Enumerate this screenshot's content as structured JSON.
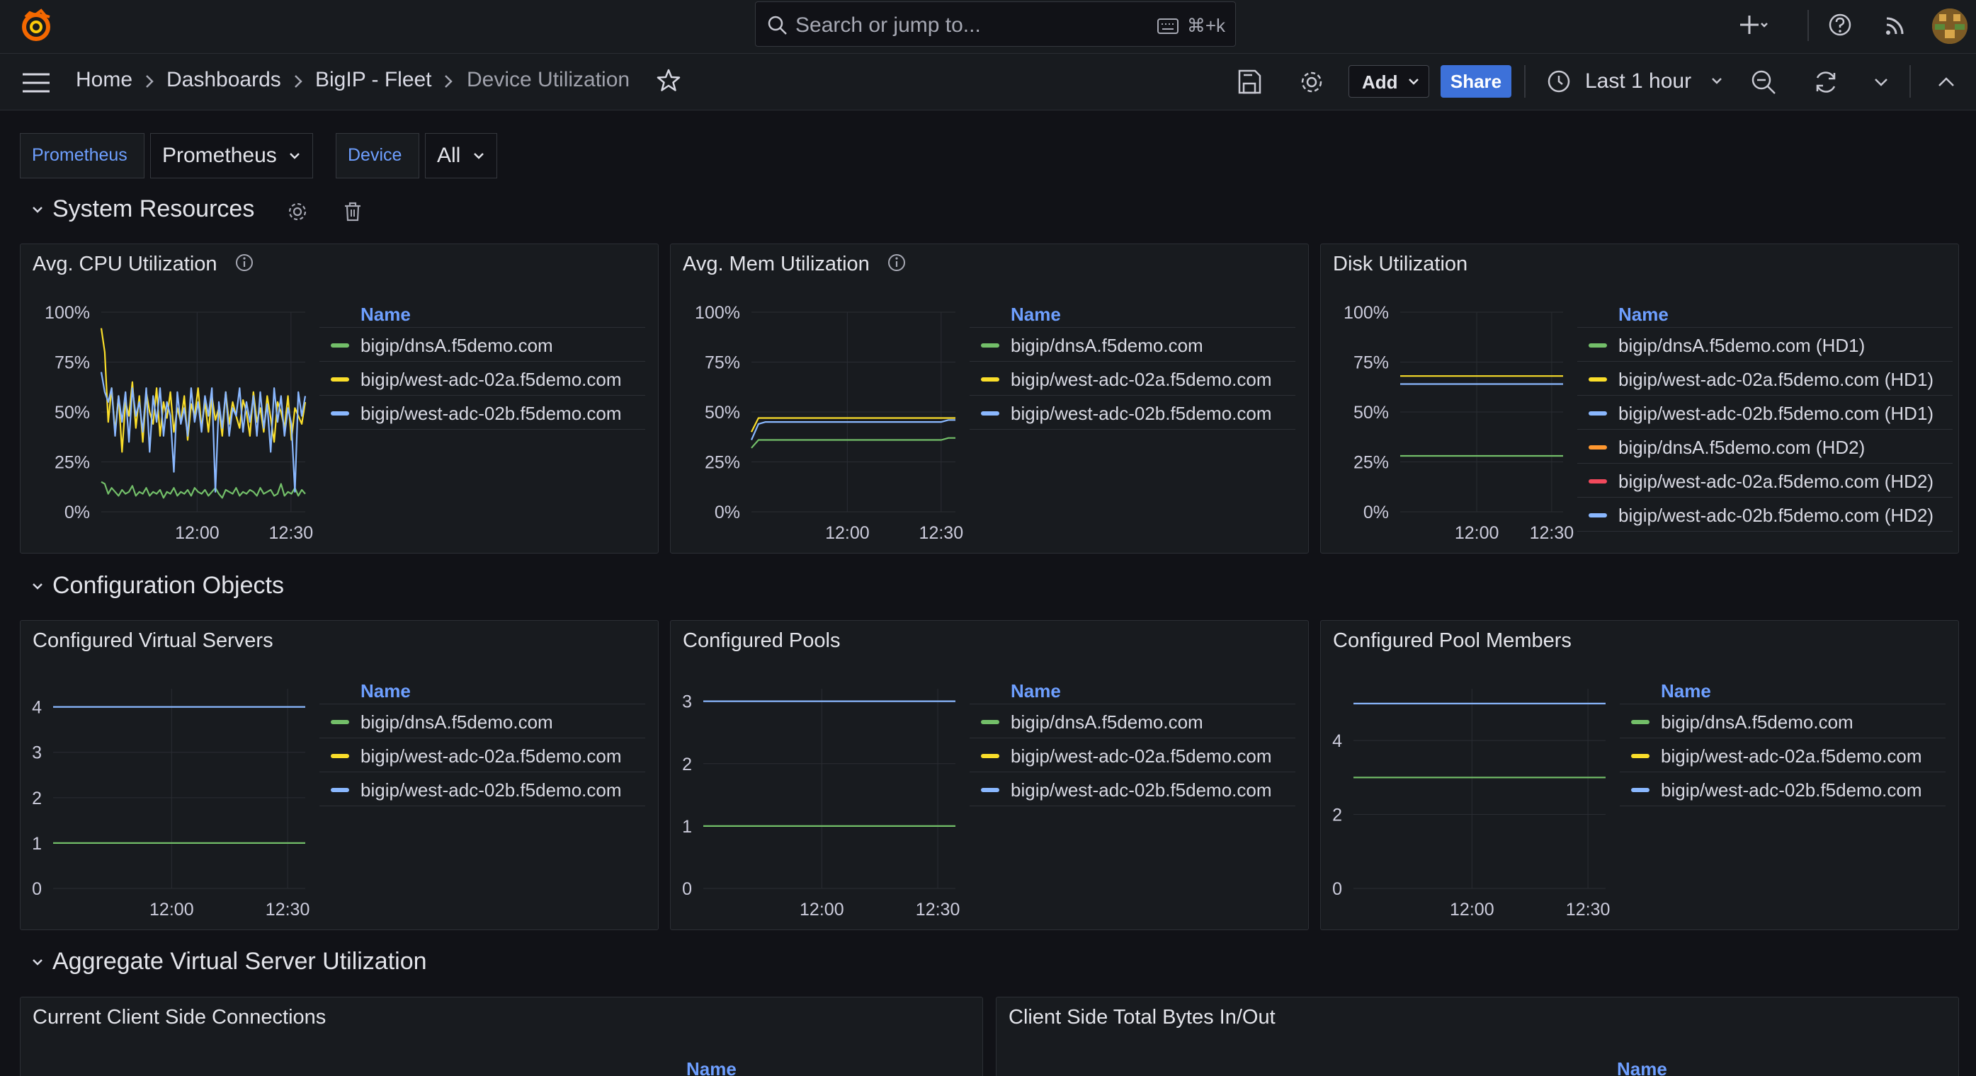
{
  "search": {
    "placeholder": "Search or jump to...",
    "shortcut": "⌘+k"
  },
  "breadcrumb": {
    "home": "Home",
    "dashboards": "Dashboards",
    "folder": "BigIP - Fleet",
    "current": "Device Utilization"
  },
  "toolbar": {
    "add_label": "Add",
    "share_label": "Share",
    "time_range": "Last 1 hour"
  },
  "variables": [
    {
      "label": "Prometheus",
      "value": "Prometheus"
    },
    {
      "label": "Device",
      "value": "All"
    }
  ],
  "rows": {
    "system": "System Resources",
    "config": "Configuration Objects",
    "aggregate": "Aggregate Virtual Server Utilization"
  },
  "colors": {
    "green": "#73bf69",
    "yellow": "#fade2a",
    "blue": "#8ab8ff",
    "orange": "#ff9830",
    "red": "#f2495c",
    "accent": "#3d71d9"
  },
  "legend_header": "Name",
  "panels": {
    "cpu": {
      "title": "Avg. CPU Utilization",
      "legend": [
        {
          "name": "bigip/dnsA.f5demo.com",
          "color": "#73bf69"
        },
        {
          "name": "bigip/west-adc-02a.f5demo.com",
          "color": "#fade2a"
        },
        {
          "name": "bigip/west-adc-02b.f5demo.com",
          "color": "#8ab8ff"
        }
      ]
    },
    "mem": {
      "title": "Avg. Mem Utilization",
      "legend": [
        {
          "name": "bigip/dnsA.f5demo.com",
          "color": "#73bf69"
        },
        {
          "name": "bigip/west-adc-02a.f5demo.com",
          "color": "#fade2a"
        },
        {
          "name": "bigip/west-adc-02b.f5demo.com",
          "color": "#8ab8ff"
        }
      ]
    },
    "disk": {
      "title": "Disk Utilization",
      "legend": [
        {
          "name": "bigip/dnsA.f5demo.com (HD1)",
          "color": "#73bf69"
        },
        {
          "name": "bigip/west-adc-02a.f5demo.com (HD1)",
          "color": "#fade2a"
        },
        {
          "name": "bigip/west-adc-02b.f5demo.com (HD1)",
          "color": "#8ab8ff"
        },
        {
          "name": "bigip/dnsA.f5demo.com (HD2)",
          "color": "#ff9830"
        },
        {
          "name": "bigip/west-adc-02a.f5demo.com (HD2)",
          "color": "#f2495c"
        },
        {
          "name": "bigip/west-adc-02b.f5demo.com (HD2)",
          "color": "#8ab8ff"
        }
      ]
    },
    "vs": {
      "title": "Configured Virtual Servers",
      "legend": [
        {
          "name": "bigip/dnsA.f5demo.com",
          "color": "#73bf69"
        },
        {
          "name": "bigip/west-adc-02a.f5demo.com",
          "color": "#fade2a"
        },
        {
          "name": "bigip/west-adc-02b.f5demo.com",
          "color": "#8ab8ff"
        }
      ]
    },
    "pools": {
      "title": "Configured Pools",
      "legend": [
        {
          "name": "bigip/dnsA.f5demo.com",
          "color": "#73bf69"
        },
        {
          "name": "bigip/west-adc-02a.f5demo.com",
          "color": "#fade2a"
        },
        {
          "name": "bigip/west-adc-02b.f5demo.com",
          "color": "#8ab8ff"
        }
      ]
    },
    "members": {
      "title": "Configured Pool Members",
      "legend": [
        {
          "name": "bigip/dnsA.f5demo.com",
          "color": "#73bf69"
        },
        {
          "name": "bigip/west-adc-02a.f5demo.com",
          "color": "#fade2a"
        },
        {
          "name": "bigip/west-adc-02b.f5demo.com",
          "color": "#8ab8ff"
        }
      ]
    },
    "conns": {
      "title": "Current Client Side Connections"
    },
    "bytes": {
      "title": "Client Side Total Bytes In/Out"
    }
  },
  "chart_data": [
    {
      "id": "cpu",
      "type": "line",
      "title": "Avg. CPU Utilization",
      "yticks": [
        "0%",
        "25%",
        "50%",
        "75%",
        "100%"
      ],
      "ylim": [
        0,
        100
      ],
      "y_unit": "%",
      "xticks": [
        "12:00",
        "12:30"
      ],
      "series": [
        {
          "name": "bigip/dnsA.f5demo.com",
          "color": "#73bf69",
          "values": [
            15,
            14,
            9,
            12,
            10,
            8,
            11,
            9,
            10,
            13,
            8,
            10,
            9,
            12,
            8,
            10,
            9,
            11,
            7,
            10,
            9,
            12,
            8,
            10,
            9,
            11,
            8,
            12,
            10,
            9,
            11,
            8,
            10,
            12,
            9,
            7,
            11,
            10,
            9,
            12,
            8,
            10,
            9,
            11,
            10,
            8,
            12,
            9,
            10,
            11,
            8,
            9,
            14,
            8,
            10,
            9,
            12,
            8,
            11,
            9
          ]
        },
        {
          "name": "bigip/west-adc-02a.f5demo.com",
          "color": "#fade2a",
          "values": [
            92,
            80,
            45,
            62,
            40,
            58,
            30,
            55,
            48,
            65,
            42,
            58,
            35,
            60,
            50,
            44,
            62,
            38,
            55,
            47,
            60,
            40,
            52,
            45,
            58,
            36,
            54,
            48,
            62,
            42,
            55,
            40,
            58,
            46,
            52,
            38,
            60,
            44,
            55,
            48,
            42,
            56,
            50,
            38,
            60,
            45,
            52,
            40,
            58,
            47,
            35,
            55,
            50,
            42,
            58,
            36,
            52,
            48,
            44,
            55
          ]
        },
        {
          "name": "bigip/west-adc-02b.f5demo.com",
          "color": "#8ab8ff",
          "values": [
            70,
            60,
            55,
            62,
            38,
            58,
            45,
            60,
            35,
            62,
            48,
            55,
            40,
            62,
            30,
            58,
            45,
            62,
            38,
            55,
            48,
            20,
            60,
            44,
            52,
            38,
            62,
            45,
            55,
            40,
            58,
            48,
            62,
            10,
            55,
            42,
            60,
            38,
            52,
            48,
            62,
            40,
            55,
            45,
            58,
            38,
            60,
            42,
            54,
            30,
            62,
            45,
            58,
            38,
            52,
            44,
            10,
            60,
            48,
            58
          ]
        }
      ]
    },
    {
      "id": "mem",
      "type": "line",
      "title": "Avg. Mem Utilization",
      "yticks": [
        "0%",
        "25%",
        "50%",
        "75%",
        "100%"
      ],
      "ylim": [
        0,
        100
      ],
      "y_unit": "%",
      "xticks": [
        "12:00",
        "12:30"
      ],
      "series": [
        {
          "name": "bigip/dnsA.f5demo.com",
          "color": "#73bf69",
          "values": [
            32,
            36,
            36,
            36,
            36,
            36,
            36,
            36,
            36,
            36,
            36,
            36,
            36,
            36,
            36,
            36,
            36,
            36,
            36,
            36,
            36,
            36,
            36,
            36,
            36,
            36,
            36,
            36,
            37,
            37
          ]
        },
        {
          "name": "bigip/west-adc-02a.f5demo.com",
          "color": "#fade2a",
          "values": [
            40,
            47,
            47,
            47,
            47,
            47,
            47,
            47,
            47,
            47,
            47,
            47,
            47,
            47,
            47,
            47,
            47,
            47,
            47,
            47,
            47,
            47,
            47,
            47,
            47,
            47,
            47,
            47,
            47,
            47
          ]
        },
        {
          "name": "bigip/west-adc-02b.f5demo.com",
          "color": "#8ab8ff",
          "values": [
            36,
            44,
            45,
            45,
            45,
            45,
            45,
            45,
            45,
            45,
            45,
            45,
            45,
            45,
            45,
            45,
            45,
            45,
            45,
            45,
            45,
            45,
            45,
            45,
            45,
            45,
            45,
            45,
            46,
            46
          ]
        }
      ]
    },
    {
      "id": "disk",
      "type": "line",
      "title": "Disk Utilization",
      "yticks": [
        "0%",
        "25%",
        "50%",
        "75%",
        "100%"
      ],
      "ylim": [
        0,
        100
      ],
      "y_unit": "%",
      "xticks": [
        "12:00",
        "12:30"
      ],
      "series": [
        {
          "name": "bigip/dnsA.f5demo.com (HD1)",
          "color": "#73bf69",
          "values": [
            28,
            28
          ]
        },
        {
          "name": "bigip/west-adc-02a.f5demo.com (HD1)",
          "color": "#fade2a",
          "values": [
            68,
            68
          ]
        },
        {
          "name": "bigip/west-adc-02b.f5demo.com (HD1)",
          "color": "#8ab8ff",
          "values": [
            64,
            64
          ]
        }
      ]
    },
    {
      "id": "vs",
      "type": "line",
      "title": "Configured Virtual Servers",
      "yticks": [
        "0",
        "1",
        "2",
        "3",
        "4"
      ],
      "ylim": [
        0,
        4.4
      ],
      "xticks": [
        "12:00",
        "12:30"
      ],
      "series": [
        {
          "name": "bigip/dnsA.f5demo.com",
          "color": "#73bf69",
          "values": [
            1,
            1
          ]
        },
        {
          "name": "bigip/west-adc-02b.f5demo.com",
          "color": "#8ab8ff",
          "values": [
            4,
            4
          ]
        }
      ]
    },
    {
      "id": "pools",
      "type": "line",
      "title": "Configured Pools",
      "yticks": [
        "0",
        "1",
        "2",
        "3"
      ],
      "ylim": [
        0,
        3.2
      ],
      "xticks": [
        "12:00",
        "12:30"
      ],
      "series": [
        {
          "name": "bigip/dnsA.f5demo.com",
          "color": "#73bf69",
          "values": [
            1,
            1
          ]
        },
        {
          "name": "bigip/west-adc-02b.f5demo.com",
          "color": "#8ab8ff",
          "values": [
            3,
            3
          ]
        }
      ]
    },
    {
      "id": "members",
      "type": "line",
      "title": "Configured Pool Members",
      "yticks": [
        "0",
        "2",
        "4"
      ],
      "ylim": [
        0,
        5.4
      ],
      "xticks": [
        "12:00",
        "12:30"
      ],
      "series": [
        {
          "name": "bigip/dnsA.f5demo.com",
          "color": "#73bf69",
          "values": [
            3,
            3
          ]
        },
        {
          "name": "bigip/west-adc-02b.f5demo.com",
          "color": "#8ab8ff",
          "values": [
            5,
            5
          ]
        }
      ]
    }
  ]
}
